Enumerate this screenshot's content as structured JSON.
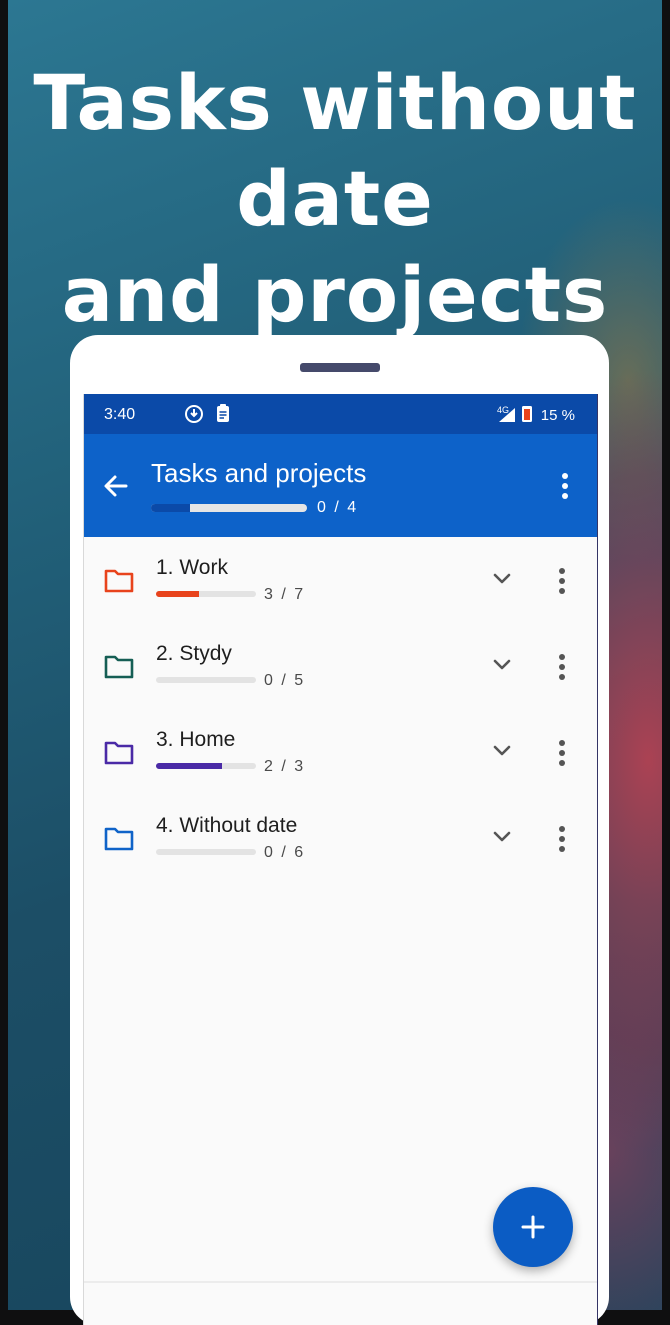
{
  "headline": {
    "line1": "Tasks without date",
    "line2": "and projects"
  },
  "status_bar": {
    "time": "3:40",
    "network": "4G",
    "battery": "15 %"
  },
  "app_bar": {
    "title": "Tasks and projects",
    "progress_count": "0 / 4",
    "progress_fraction": 0.25
  },
  "projects": [
    {
      "title": "1. Work",
      "count": "3 / 7",
      "progress": 0.43,
      "color": "#e8431c"
    },
    {
      "title": "2. Stydy",
      "count": "0 / 5",
      "progress": 0,
      "color": "#155e54"
    },
    {
      "title": "3. Home",
      "count": "2 / 3",
      "progress": 0.66,
      "color": "#4a2aa6"
    },
    {
      "title": "4. Without date",
      "count": "0 / 6",
      "progress": 0,
      "color": "#0f63c8"
    }
  ],
  "colors": {
    "status_bar": "#0b4aa8",
    "app_bar": "#0d62c9",
    "fab": "#0b5cc4"
  },
  "icons": [
    "back-arrow-icon",
    "more-vert-icon",
    "folder-icon",
    "chevron-down-icon",
    "plus-icon"
  ]
}
